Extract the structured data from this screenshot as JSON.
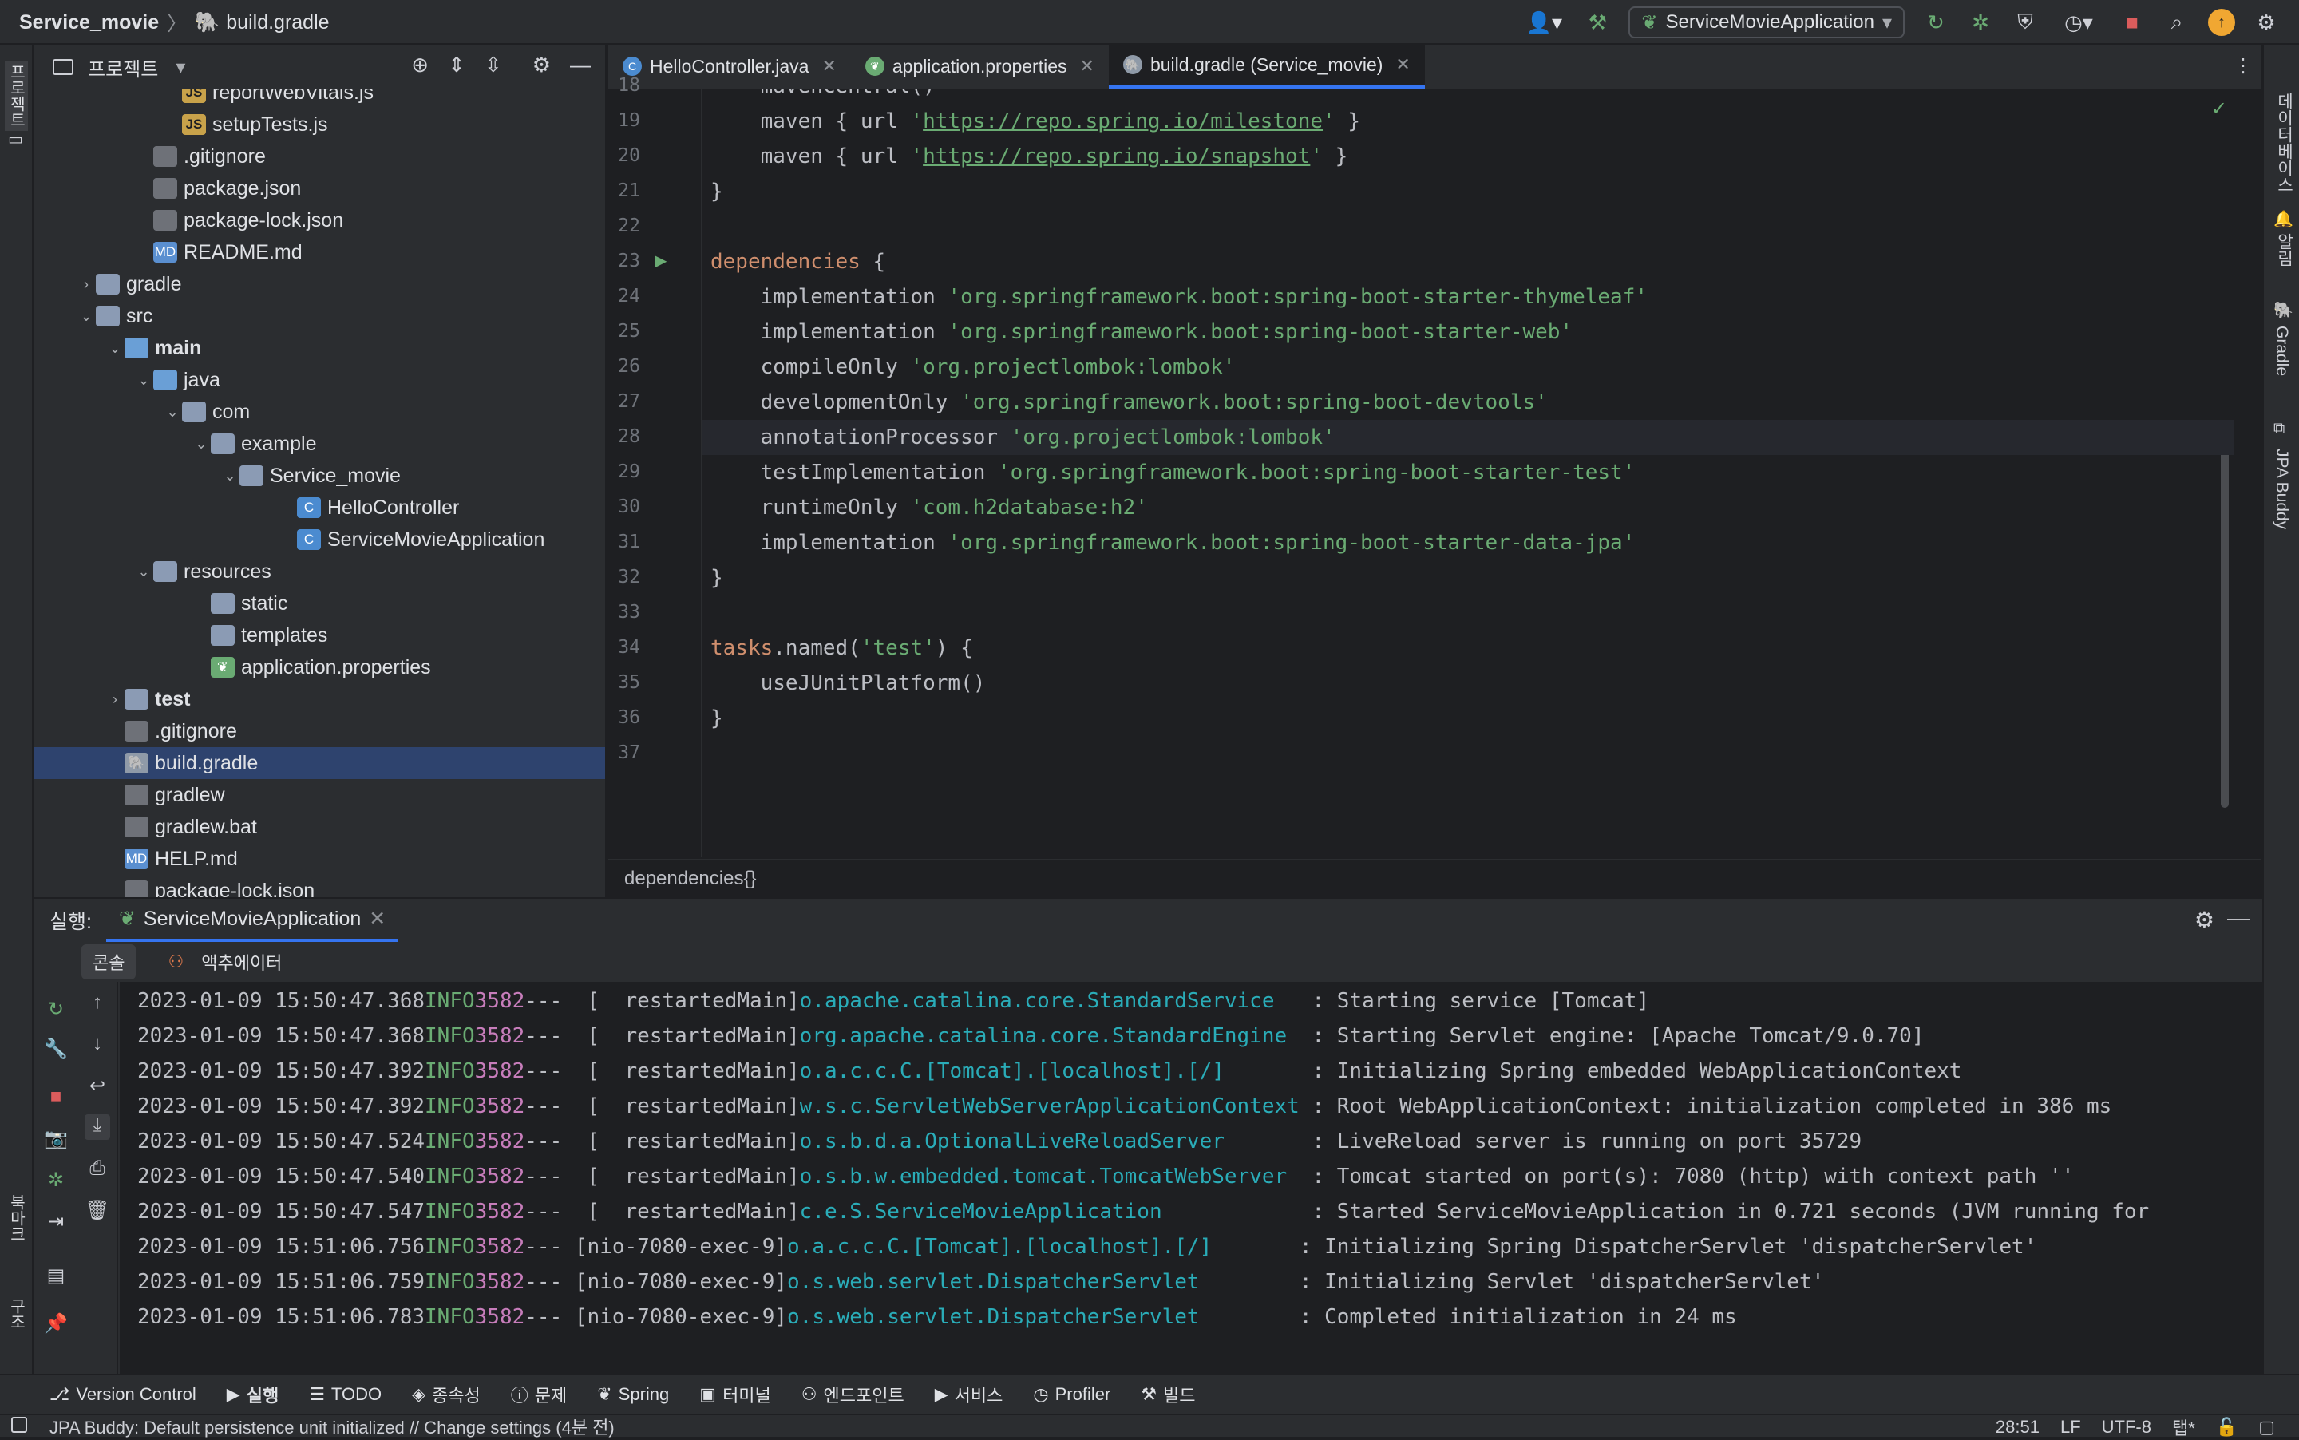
{
  "titlebar": {
    "project": "Service_movie",
    "file": "build.gradle",
    "run_config": "ServiceMovieApplication"
  },
  "left_strip": {
    "project_tab": "프로젝트",
    "bookmarks": "북마크",
    "structure": "구조"
  },
  "right_strip": {
    "database": "데이터베이스",
    "notifications": "알림",
    "gradle": "Gradle",
    "jpa_buddy": "JPA Buddy"
  },
  "project_panel": {
    "title": "프로젝트",
    "tree": [
      {
        "label": "reportWebVitals.js",
        "indent": 4,
        "icon": "js",
        "arrow": ""
      },
      {
        "label": "setupTests.js",
        "indent": 4,
        "icon": "js",
        "arrow": ""
      },
      {
        "label": ".gitignore",
        "indent": 3,
        "icon": "file",
        "arrow": ""
      },
      {
        "label": "package.json",
        "indent": 3,
        "icon": "file",
        "arrow": ""
      },
      {
        "label": "package-lock.json",
        "indent": 3,
        "icon": "file",
        "arrow": ""
      },
      {
        "label": "README.md",
        "indent": 3,
        "icon": "md",
        "arrow": ""
      },
      {
        "label": "gradle",
        "indent": 1,
        "icon": "folder",
        "arrow": "›"
      },
      {
        "label": "src",
        "indent": 1,
        "icon": "folder",
        "arrow": "⌄"
      },
      {
        "label": "main",
        "indent": 2,
        "icon": "folder-src",
        "arrow": "⌄",
        "bold": true
      },
      {
        "label": "java",
        "indent": 3,
        "icon": "folder-src",
        "arrow": "⌄"
      },
      {
        "label": "com",
        "indent": 4,
        "icon": "folder",
        "arrow": "⌄"
      },
      {
        "label": "example",
        "indent": 5,
        "icon": "folder",
        "arrow": "⌄"
      },
      {
        "label": "Service_movie",
        "indent": 6,
        "icon": "folder",
        "arrow": "⌄"
      },
      {
        "label": "HelloController",
        "indent": 8,
        "icon": "class",
        "arrow": ""
      },
      {
        "label": "ServiceMovieApplication",
        "indent": 8,
        "icon": "class",
        "arrow": ""
      },
      {
        "label": "resources",
        "indent": 3,
        "icon": "folder",
        "arrow": "⌄"
      },
      {
        "label": "static",
        "indent": 5,
        "icon": "folder",
        "arrow": ""
      },
      {
        "label": "templates",
        "indent": 5,
        "icon": "folder",
        "arrow": ""
      },
      {
        "label": "application.properties",
        "indent": 5,
        "icon": "spring",
        "arrow": ""
      },
      {
        "label": "test",
        "indent": 2,
        "icon": "folder",
        "arrow": "›",
        "bold": true
      },
      {
        "label": ".gitignore",
        "indent": 2,
        "icon": "file",
        "arrow": ""
      },
      {
        "label": "build.gradle",
        "indent": 2,
        "icon": "gradle",
        "arrow": "",
        "selected": true
      },
      {
        "label": "gradlew",
        "indent": 2,
        "icon": "file",
        "arrow": ""
      },
      {
        "label": "gradlew.bat",
        "indent": 2,
        "icon": "file",
        "arrow": ""
      },
      {
        "label": "HELP.md",
        "indent": 2,
        "icon": "md",
        "arrow": ""
      },
      {
        "label": "package-lock.json",
        "indent": 2,
        "icon": "file",
        "arrow": ""
      }
    ]
  },
  "editor": {
    "tabs": [
      {
        "label": "HelloController.java",
        "icon": "class",
        "active": false
      },
      {
        "label": "application.properties",
        "icon": "spring",
        "active": false
      },
      {
        "label": "build.gradle (Service_movie)",
        "icon": "gradle",
        "active": true
      }
    ],
    "lines": [
      {
        "n": "18",
        "parts": [
          [
            "",
            "    mavenCentral()"
          ]
        ]
      },
      {
        "n": "19",
        "parts": [
          [
            "",
            "    maven { url "
          ],
          [
            "str",
            "'"
          ],
          [
            "url",
            "https://repo.spring.io/milestone"
          ],
          [
            "str",
            "'"
          ],
          [
            "",
            " }"
          ]
        ]
      },
      {
        "n": "20",
        "parts": [
          [
            "",
            "    maven { url "
          ],
          [
            "str",
            "'"
          ],
          [
            "url",
            "https://repo.spring.io/snapshot"
          ],
          [
            "str",
            "'"
          ],
          [
            "",
            " }"
          ]
        ]
      },
      {
        "n": "21",
        "parts": [
          [
            "",
            "}"
          ]
        ]
      },
      {
        "n": "22",
        "parts": [
          [
            "",
            ""
          ]
        ]
      },
      {
        "n": "23",
        "parts": [
          [
            "kw",
            "dependencies"
          ],
          [
            "",
            " {"
          ]
        ],
        "run": true
      },
      {
        "n": "24",
        "parts": [
          [
            "",
            "    implementation "
          ],
          [
            "str",
            "'org.springframework.boot:spring-boot-starter-thymeleaf'"
          ]
        ]
      },
      {
        "n": "25",
        "parts": [
          [
            "",
            "    implementation "
          ],
          [
            "str",
            "'org.springframework.boot:spring-boot-starter-web'"
          ]
        ]
      },
      {
        "n": "26",
        "parts": [
          [
            "",
            "    compileOnly "
          ],
          [
            "str",
            "'org.projectlombok:lombok'"
          ]
        ]
      },
      {
        "n": "27",
        "parts": [
          [
            "",
            "    developmentOnly "
          ],
          [
            "str",
            "'org.springframework.boot:spring-boot-devtools'"
          ]
        ]
      },
      {
        "n": "28",
        "parts": [
          [
            "",
            "    annotationProcessor "
          ],
          [
            "str",
            "'org.projectlombok:lombok'"
          ]
        ],
        "current": true
      },
      {
        "n": "29",
        "parts": [
          [
            "",
            "    testImplementation "
          ],
          [
            "str",
            "'org.springframework.boot:spring-boot-starter-test'"
          ]
        ]
      },
      {
        "n": "30",
        "parts": [
          [
            "",
            "    runtimeOnly "
          ],
          [
            "str",
            "'com.h2database:h2'"
          ]
        ]
      },
      {
        "n": "31",
        "parts": [
          [
            "",
            "    implementation "
          ],
          [
            "str",
            "'org.springframework.boot:spring-boot-starter-data-jpa'"
          ]
        ]
      },
      {
        "n": "32",
        "parts": [
          [
            "",
            "}"
          ]
        ]
      },
      {
        "n": "33",
        "parts": [
          [
            "",
            ""
          ]
        ]
      },
      {
        "n": "34",
        "parts": [
          [
            "kw",
            "tasks"
          ],
          [
            "",
            ".named("
          ],
          [
            "str",
            "'test'"
          ],
          [
            "",
            ") {"
          ]
        ]
      },
      {
        "n": "35",
        "parts": [
          [
            "",
            "    useJUnitPlatform()"
          ]
        ]
      },
      {
        "n": "36",
        "parts": [
          [
            "",
            "}"
          ]
        ]
      },
      {
        "n": "37",
        "parts": [
          [
            "",
            ""
          ]
        ]
      }
    ],
    "breadcrumb": "dependencies{}"
  },
  "run_panel": {
    "label": "실행:",
    "tab": "ServiceMovieApplication",
    "subtabs": [
      "콘솔",
      "액추에이터"
    ],
    "log": [
      {
        "ts": "2023-01-09 15:50:47.368",
        "lvl": "INFO",
        "pid": "3582",
        "thread": "---  [  restartedMain]",
        "logger": "o.apache.catalina.core.StandardService   ",
        "msg": ": Starting service [Tomcat]"
      },
      {
        "ts": "2023-01-09 15:50:47.368",
        "lvl": "INFO",
        "pid": "3582",
        "thread": "---  [  restartedMain]",
        "logger": "org.apache.catalina.core.StandardEngine  ",
        "msg": ": Starting Servlet engine: [Apache Tomcat/9.0.70]"
      },
      {
        "ts": "2023-01-09 15:50:47.392",
        "lvl": "INFO",
        "pid": "3582",
        "thread": "---  [  restartedMain]",
        "logger": "o.a.c.c.C.[Tomcat].[localhost].[/]       ",
        "msg": ": Initializing Spring embedded WebApplicationContext"
      },
      {
        "ts": "2023-01-09 15:50:47.392",
        "lvl": "INFO",
        "pid": "3582",
        "thread": "---  [  restartedMain]",
        "logger": "w.s.c.ServletWebServerApplicationContext ",
        "msg": ": Root WebApplicationContext: initialization completed in 386 ms"
      },
      {
        "ts": "2023-01-09 15:50:47.524",
        "lvl": "INFO",
        "pid": "3582",
        "thread": "---  [  restartedMain]",
        "logger": "o.s.b.d.a.OptionalLiveReloadServer       ",
        "msg": ": LiveReload server is running on port 35729"
      },
      {
        "ts": "2023-01-09 15:50:47.540",
        "lvl": "INFO",
        "pid": "3582",
        "thread": "---  [  restartedMain]",
        "logger": "o.s.b.w.embedded.tomcat.TomcatWebServer  ",
        "msg": ": Tomcat started on port(s): 7080 (http) with context path ''"
      },
      {
        "ts": "2023-01-09 15:50:47.547",
        "lvl": "INFO",
        "pid": "3582",
        "thread": "---  [  restartedMain]",
        "logger": "c.e.S.ServiceMovieApplication            ",
        "msg": ": Started ServiceMovieApplication in 0.721 seconds (JVM running for"
      },
      {
        "ts": "2023-01-09 15:51:06.756",
        "lvl": "INFO",
        "pid": "3582",
        "thread": "--- [nio-7080-exec-9]",
        "logger": "o.a.c.c.C.[Tomcat].[localhost].[/]       ",
        "msg": ": Initializing Spring DispatcherServlet 'dispatcherServlet'"
      },
      {
        "ts": "2023-01-09 15:51:06.759",
        "lvl": "INFO",
        "pid": "3582",
        "thread": "--- [nio-7080-exec-9]",
        "logger": "o.s.web.servlet.DispatcherServlet        ",
        "msg": ": Initializing Servlet 'dispatcherServlet'"
      },
      {
        "ts": "2023-01-09 15:51:06.783",
        "lvl": "INFO",
        "pid": "3582",
        "thread": "--- [nio-7080-exec-9]",
        "logger": "o.s.web.servlet.DispatcherServlet        ",
        "msg": ": Completed initialization in 24 ms"
      }
    ]
  },
  "bottom_bar": [
    {
      "label": "Version Control",
      "icon": "⎇"
    },
    {
      "label": "실행",
      "icon": "▶",
      "active": true
    },
    {
      "label": "TODO",
      "icon": "☰"
    },
    {
      "label": "종속성",
      "icon": "◈"
    },
    {
      "label": "문제",
      "icon": "ⓘ"
    },
    {
      "label": "Spring",
      "icon": "❦"
    },
    {
      "label": "터미널",
      "icon": "▣"
    },
    {
      "label": "엔드포인트",
      "icon": "⚇"
    },
    {
      "label": "서비스",
      "icon": "▶"
    },
    {
      "label": "Profiler",
      "icon": "◷"
    },
    {
      "label": "빌드",
      "icon": "⚒"
    }
  ],
  "status_bar": {
    "message": "JPA Buddy: Default persistence unit initialized // Change settings (4분 전)",
    "position": "28:51",
    "line_sep": "LF",
    "encoding": "UTF-8",
    "indent": "탭*"
  },
  "colors": {
    "accent": "#3574f0",
    "selection": "#2e436e",
    "string": "#6aab73",
    "keyword": "#cf8e6d"
  }
}
